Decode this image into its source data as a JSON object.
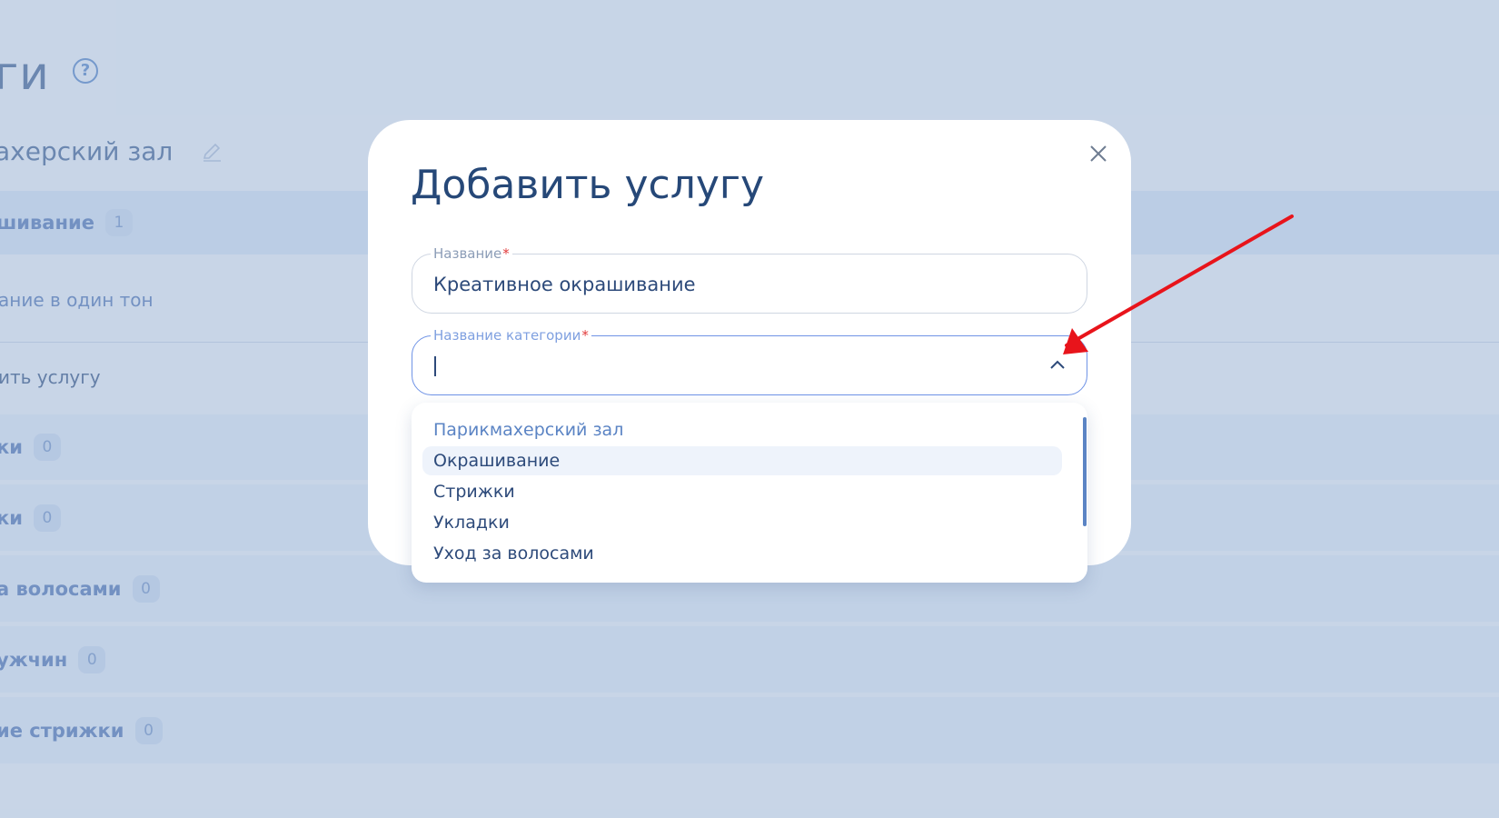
{
  "page": {
    "title": "ги",
    "category": "ахерский зал"
  },
  "rows": [
    {
      "label": "шивание",
      "count": "1"
    },
    {
      "label": "ание в один тон"
    },
    {
      "label": "ить услугу"
    },
    {
      "label": "ки",
      "count": "0"
    },
    {
      "label": "ки",
      "count": "0"
    },
    {
      "label": "а волосами",
      "count": "0"
    },
    {
      "label": "ужчин",
      "count": "0"
    },
    {
      "label": "ие стрижки",
      "count": "0"
    }
  ],
  "modal": {
    "title": "Добавить услугу",
    "name_field": {
      "label": "Название",
      "required_mark": "*",
      "value": "Креативное окрашивание"
    },
    "category_field": {
      "label": "Название категории",
      "required_mark": "*",
      "value": ""
    },
    "dropdown": {
      "options": [
        "Парикмахерский зал",
        "Окрашивание",
        "Стрижки",
        "Укладки",
        "Уход за волосами"
      ]
    }
  },
  "colors": {
    "primary_text": "#264878",
    "accent_blue": "#5b84c4",
    "focus_border": "#6f93e6",
    "annotation_arrow": "#e8141b"
  },
  "icons": {
    "help": "question-circle-icon",
    "edit": "pencil-icon",
    "close": "close-icon",
    "dropdown_toggle": "chevron-up-icon"
  }
}
